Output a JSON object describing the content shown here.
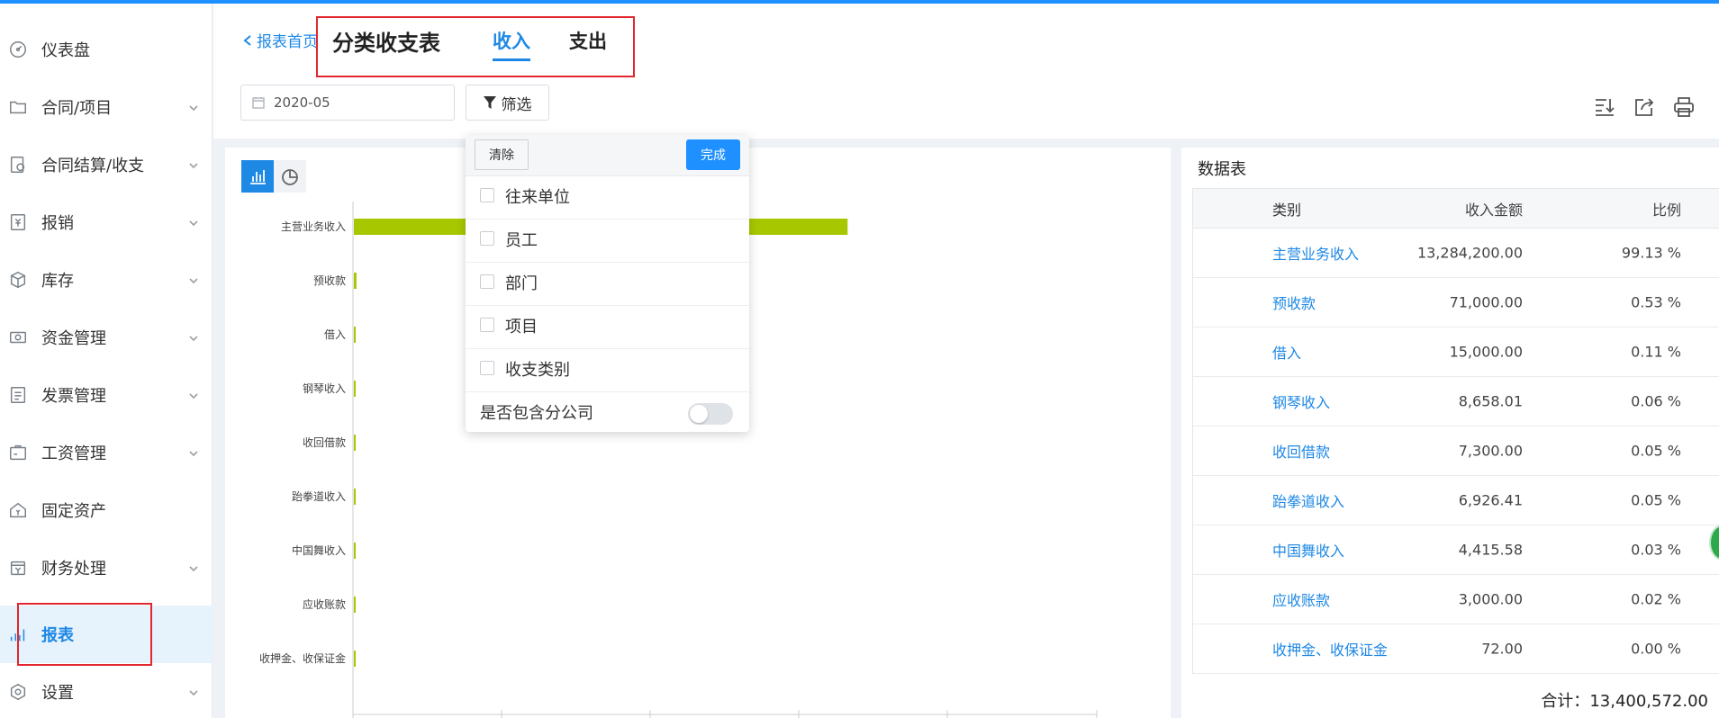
{
  "sidebar": {
    "items": [
      {
        "label": "仪表盘",
        "icon": "dashboard-icon",
        "chevron": false,
        "active": false
      },
      {
        "label": "合同/项目",
        "icon": "folder-icon",
        "chevron": true,
        "active": false
      },
      {
        "label": "合同结算/收支",
        "icon": "settlement-icon",
        "chevron": true,
        "active": false
      },
      {
        "label": "报销",
        "icon": "reimburse-icon",
        "chevron": true,
        "active": false
      },
      {
        "label": "库存",
        "icon": "inventory-box-icon",
        "chevron": true,
        "active": false
      },
      {
        "label": "资金管理",
        "icon": "fund-icon",
        "chevron": true,
        "active": false
      },
      {
        "label": "发票管理",
        "icon": "invoice-icon",
        "chevron": true,
        "active": false
      },
      {
        "label": "工资管理",
        "icon": "salary-icon",
        "chevron": true,
        "active": false
      },
      {
        "label": "固定资产",
        "icon": "fixed-asset-icon",
        "chevron": false,
        "active": false
      },
      {
        "label": "财务处理",
        "icon": "finance-icon",
        "chevron": true,
        "active": false
      },
      {
        "label": "报表",
        "icon": "report-chart-icon",
        "chevron": false,
        "active": true
      },
      {
        "label": "设置",
        "icon": "settings-icon",
        "chevron": true,
        "active": false
      }
    ]
  },
  "header": {
    "back_label": "报表首页",
    "title": "分类收支表",
    "tabs": [
      {
        "label": "收入",
        "active": true
      },
      {
        "label": "支出",
        "active": false
      }
    ]
  },
  "toolbar": {
    "date_value": "2020-05",
    "filter_label": "筛选",
    "icons": [
      "sort-download-icon",
      "export-icon",
      "print-icon"
    ]
  },
  "filter_dropdown": {
    "clear_label": "清除",
    "done_label": "完成",
    "options": [
      "往来单位",
      "员工",
      "部门",
      "项目",
      "收支类别"
    ],
    "switch_label": "是否包含分公司",
    "switch_on": false
  },
  "chart_data": {
    "type": "bar",
    "orientation": "horizontal",
    "categories": [
      "主营业务收入",
      "预收款",
      "借入",
      "钢琴收入",
      "收回借款",
      "跆拳道收入",
      "中国舞收入",
      "应收账款",
      "收押金、收保证金"
    ],
    "values": [
      13284200.0,
      71000.0,
      15000.0,
      8658.01,
      7300.0,
      6926.41,
      4415.58,
      3000.0,
      72.0
    ],
    "color": "#a7c800",
    "xlim": [
      0,
      22000000
    ]
  },
  "data_table": {
    "title": "数据表",
    "headers": {
      "category": "类别",
      "amount": "收入金额",
      "ratio": "比例"
    },
    "rows": [
      {
        "category": "主营业务收入",
        "amount": "13,284,200.00",
        "ratio": "99.13 %"
      },
      {
        "category": "预收款",
        "amount": "71,000.00",
        "ratio": "0.53 %"
      },
      {
        "category": "借入",
        "amount": "15,000.00",
        "ratio": "0.11 %"
      },
      {
        "category": "钢琴收入",
        "amount": "8,658.01",
        "ratio": "0.06 %"
      },
      {
        "category": "收回借款",
        "amount": "7,300.00",
        "ratio": "0.05 %"
      },
      {
        "category": "跆拳道收入",
        "amount": "6,926.41",
        "ratio": "0.05 %"
      },
      {
        "category": "中国舞收入",
        "amount": "4,415.58",
        "ratio": "0.03 %"
      },
      {
        "category": "应收账款",
        "amount": "3,000.00",
        "ratio": "0.02 %"
      },
      {
        "category": "收押金、收保证金",
        "amount": "72.00",
        "ratio": "0.00 %"
      }
    ],
    "total_label": "合计：",
    "total_value": "13,400,572.00"
  },
  "colors": {
    "accent": "#1e88e5",
    "bar": "#a7c800",
    "highlight": "#e0282e"
  }
}
